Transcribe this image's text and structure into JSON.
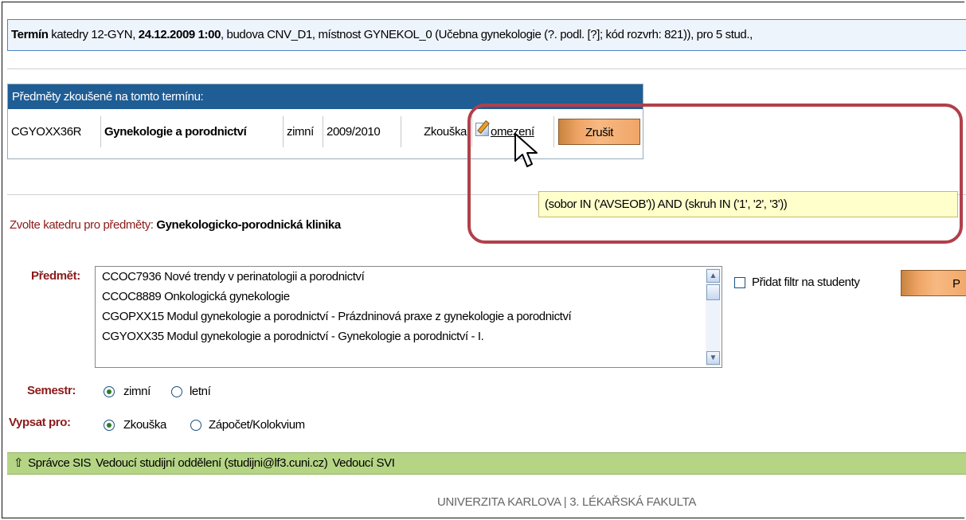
{
  "header": {
    "termin_label": "Termín",
    "text1": " katedry 12-GYN, ",
    "date": "24.12.2009 1:00",
    "text2": ", budova CNV_D1, místnost GYNEKOL_0 (Učebna gynekologie (?. podl. [?]; kód rozvrh: 821)), pro 5 stud., "
  },
  "subjects": {
    "title": "Předměty zkoušené na tomto termínu:",
    "row": {
      "code": "CGYOXX36R",
      "name": "Gynekologie a porodnictví",
      "semester": "zimní",
      "year": "2009/2010",
      "type": "Zkouška",
      "restriction_link": "omezení",
      "cancel_button": "Zrušit"
    }
  },
  "tooltip": "(sobor IN ('AVSEOB')) AND (skruh IN ('1', '2', '3'))",
  "katedra": {
    "label": "Zvolte katedru pro předměty:",
    "value": "Gynekologicko-porodnická klinika"
  },
  "predmet": {
    "label": "Předmět:",
    "options": [
      "CCOC7936 Nové trendy v perinatologii a porodnictví",
      "CCOC8889 Onkologická gynekologie",
      "CGOPXX15 Modul gynekologie a porodnictví - Prázdninová praxe z gynekologie a porodnictví",
      "CGYOXX35 Modul gynekologie a porodnictví - Gynekologie a porodnictví - I."
    ]
  },
  "filter": {
    "checkbox_label": "Přidat filtr na studenty",
    "button_label": "P"
  },
  "semestr": {
    "label": "Semestr:",
    "options": [
      "zimní",
      "letní"
    ],
    "selected": "zimní"
  },
  "vypsat": {
    "label": "Vypsat pro:",
    "options": [
      "Zkouška",
      "Zápočet/Kolokvium"
    ],
    "selected": "Zkouška"
  },
  "footer": {
    "arrow": "⇧",
    "items": [
      "Správce SIS",
      "Vedoucí studijní oddělení (studijni@lf3.cuni.cz)",
      "Vedoucí SVI"
    ]
  },
  "university": "UNIVERZITA KARLOVA | 3. LÉKAŘSKÁ FAKULTA",
  "colors": {
    "accent_blue": "#1f5d95",
    "label_red": "#8b1a1a",
    "footer_green": "#b5d585",
    "button_orange": "#f0a567",
    "highlight": "#b0404a",
    "tooltip_bg": "#ffffcc"
  }
}
